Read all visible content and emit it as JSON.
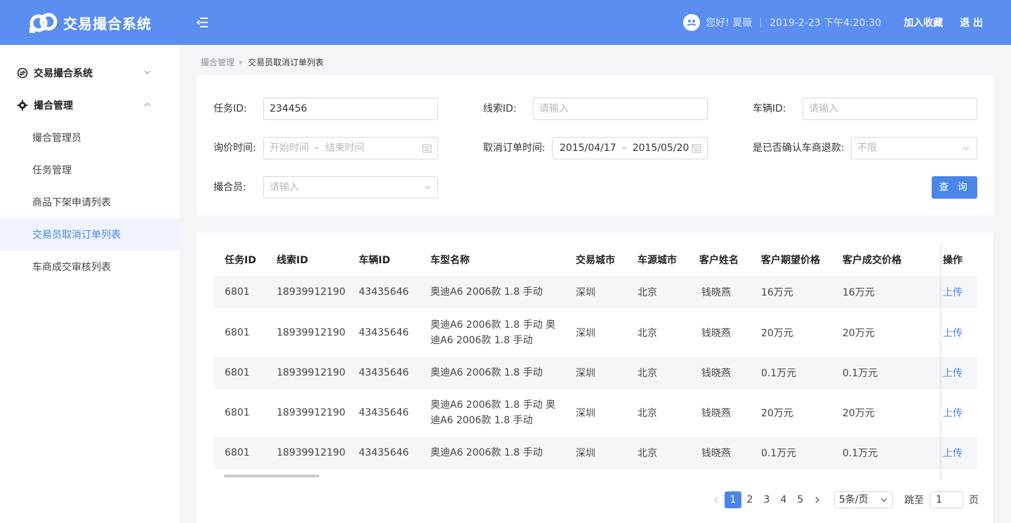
{
  "header": {
    "app_title": "交易撮合系统",
    "greeting": "您好! 夏薇",
    "datetime": "2019-2-23 下午4:20:30",
    "favorite_label": "加入收藏",
    "logout_label": "退 出"
  },
  "sidebar": {
    "groups": [
      {
        "label": "交易撮合系统",
        "icon": "exchange-icon",
        "expanded": false
      },
      {
        "label": "撮合管理",
        "icon": "gear-icon",
        "expanded": true
      }
    ],
    "items": [
      {
        "label": "撮合管理员"
      },
      {
        "label": "任务管理"
      },
      {
        "label": "商品下架申请列表"
      },
      {
        "label": "交易员取消订单列表",
        "active": true
      },
      {
        "label": "车商成交审核列表"
      }
    ]
  },
  "breadcrumb": {
    "parent": "撮合管理",
    "current": "交易员取消订单列表"
  },
  "filters": {
    "task_id": {
      "label": "任务ID:",
      "value": "234456"
    },
    "lead_id": {
      "label": "线索ID:",
      "placeholder": "请输入"
    },
    "vehicle_id": {
      "label": "车辆ID:",
      "placeholder": "请输入"
    },
    "inquiry_time": {
      "label": "询价时间:",
      "start_placeholder": "开始时间",
      "end_placeholder": "结束时间",
      "sep": "–"
    },
    "cancel_time": {
      "label": "取消订单时间:",
      "start": "2015/04/17",
      "end": "2015/05/20",
      "sep": "–"
    },
    "refund_confirmed": {
      "label": "是已否确认车商退款:",
      "placeholder": "不限"
    },
    "matcher": {
      "label": "撮合员:",
      "placeholder": "请输入"
    },
    "query_label": "查 询"
  },
  "table": {
    "columns": [
      "任务ID",
      "线索ID",
      "车辆ID",
      "车型名称",
      "交易城市",
      "车源城市",
      "客户姓名",
      "客户期望价格",
      "客户成交价格",
      "操作"
    ],
    "rows": [
      {
        "task_id": "6801",
        "lead_id": "18939912190",
        "vehicle_id": "43435646",
        "car_line1": "奥迪A6 2006款 1.8 手动",
        "car_line2": "",
        "trade_city": "深圳",
        "source_city": "北京",
        "customer": "钱晓燕",
        "expected": "16万元",
        "deal": "16万元",
        "action": "上传"
      },
      {
        "task_id": "6801",
        "lead_id": "18939912190",
        "vehicle_id": "43435646",
        "car_line1": "奥迪A6 2006款 1.8 手动 奥",
        "car_line2": "迪A6 2006款 1.8 手动",
        "trade_city": "深圳",
        "source_city": "北京",
        "customer": "钱晓燕",
        "expected": "20万元",
        "deal": "20万元",
        "action": "上传"
      },
      {
        "task_id": "6801",
        "lead_id": "18939912190",
        "vehicle_id": "43435646",
        "car_line1": "奥迪A6 2006款 1.8 手动",
        "car_line2": "",
        "trade_city": "深圳",
        "source_city": "北京",
        "customer": "钱晓燕",
        "expected": "0.1万元",
        "deal": "0.1万元",
        "action": "上传"
      },
      {
        "task_id": "6801",
        "lead_id": "18939912190",
        "vehicle_id": "43435646",
        "car_line1": "奥迪A6 2006款 1.8 手动 奥",
        "car_line2": "迪A6 2006款 1.8 手动",
        "trade_city": "深圳",
        "source_city": "北京",
        "customer": "钱晓燕",
        "expected": "20万元",
        "deal": "20万元",
        "action": "上传"
      },
      {
        "task_id": "6801",
        "lead_id": "18939912190",
        "vehicle_id": "43435646",
        "car_line1": "奥迪A6 2006款 1.8 手动",
        "car_line2": "",
        "trade_city": "深圳",
        "source_city": "北京",
        "customer": "钱晓燕",
        "expected": "0.1万元",
        "deal": "0.1万元",
        "action": "上传"
      }
    ]
  },
  "pagination": {
    "pages": [
      "1",
      "2",
      "3",
      "4",
      "5"
    ],
    "current_page": "1",
    "page_size": "5条/页",
    "jump_label": "跳至",
    "jump_value": "1",
    "unit_label": "页"
  },
  "colors": {
    "primary": "#4a86e8",
    "header_bg": "#5a8ef0",
    "sidebar_active_bg": "#eef3fd"
  }
}
